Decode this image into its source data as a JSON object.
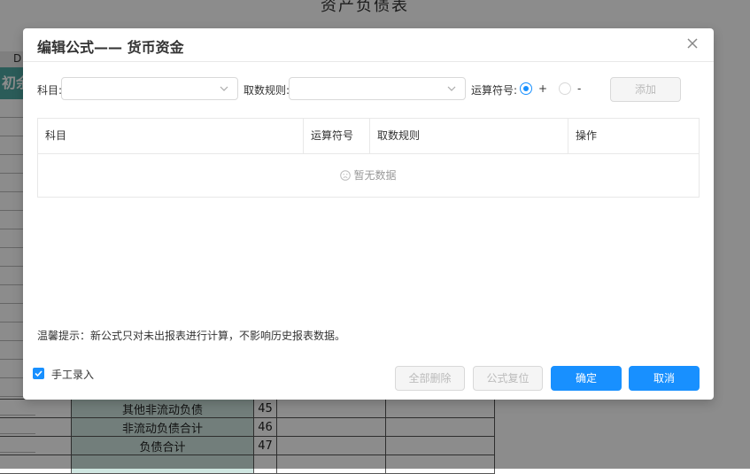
{
  "background": {
    "sheet_title": "资产负债表",
    "column_header": "D",
    "teal_header_text": "初余",
    "rows": [
      {
        "name": "其他非流动负债",
        "line": "45"
      },
      {
        "name": "非流动负债合计",
        "line": "46"
      },
      {
        "name": "负债合计",
        "line": "47"
      }
    ]
  },
  "dialog": {
    "title": "编辑公式—— 货币资金",
    "close_icon": "close-icon",
    "form": {
      "subject_label": "科目:",
      "subject_value": "",
      "rule_label": "取数规则:",
      "rule_value": "",
      "operator_label": "运算符号:",
      "operator_plus": "+",
      "operator_minus": "-",
      "operator_selected": "+",
      "add_button": "添加"
    },
    "table": {
      "columns": [
        "科目",
        "运算符号",
        "取数规则",
        "操作"
      ],
      "rows": [],
      "empty_text": "暂无数据"
    },
    "tip": "温馨提示：新公式只对未出报表进行计算，不影响历史报表数据。",
    "footer": {
      "manual_entry_label": "手工录入",
      "manual_entry_checked": true,
      "delete_all_button": "全部删除",
      "reset_button": "公式复位",
      "confirm_button": "确定",
      "cancel_button": "取消"
    }
  },
  "colors": {
    "primary": "#1890ff",
    "teal": "#4fa8a2",
    "overlay": "rgba(0,0,0,0.45)"
  }
}
